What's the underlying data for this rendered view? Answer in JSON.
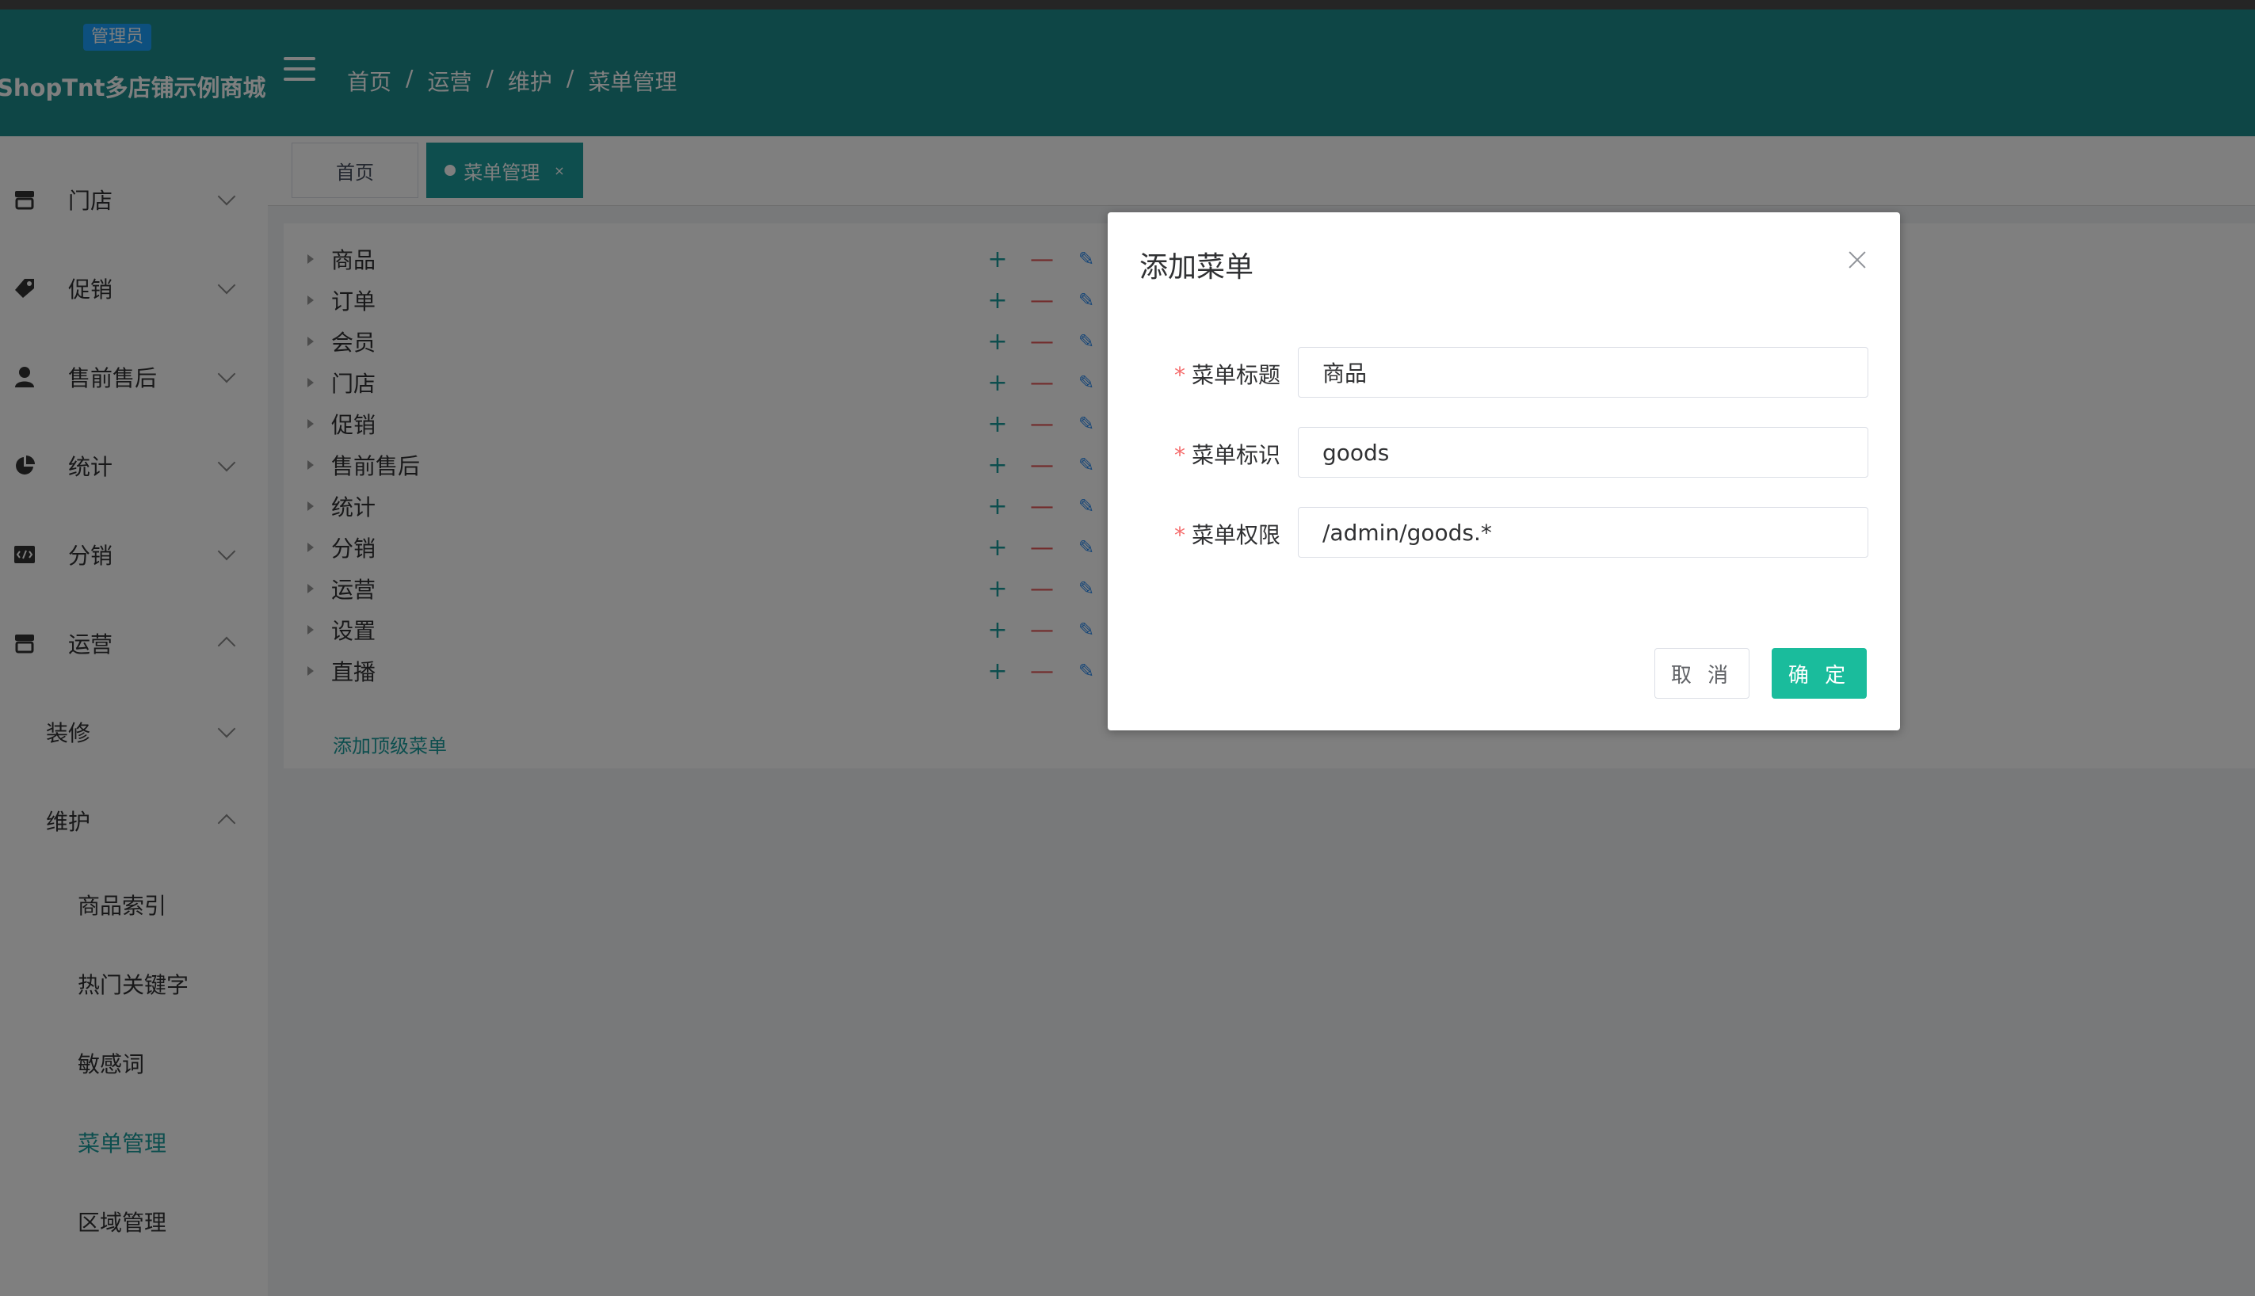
{
  "header": {
    "role_badge": "管理员",
    "shop_name": "ShopTnt多店铺示例商城",
    "breadcrumb": [
      "首页",
      "运营",
      "维护",
      "菜单管理"
    ],
    "separator": "/"
  },
  "sidebar": {
    "items": [
      {
        "label": "门店",
        "icon": "store-icon"
      },
      {
        "label": "促销",
        "icon": "tag-icon"
      },
      {
        "label": "售前售后",
        "icon": "user-icon"
      },
      {
        "label": "统计",
        "icon": "pie-chart-icon"
      },
      {
        "label": "分销",
        "icon": "code-icon"
      },
      {
        "label": "运营",
        "icon": "store-icon"
      }
    ],
    "subitems": [
      "装修",
      "维护"
    ],
    "leaf_items": [
      "商品索引",
      "热门关键字",
      "敏感词",
      "菜单管理",
      "区域管理"
    ],
    "active_item": "菜单管理"
  },
  "tabs": {
    "home": "首页",
    "active": "菜单管理",
    "close_glyph": "×"
  },
  "tree": {
    "nodes": [
      "商品",
      "订单",
      "会员",
      "门店",
      "促销",
      "售前售后",
      "统计",
      "分销",
      "运营",
      "设置",
      "直播"
    ],
    "add_glyph": "+",
    "remove_glyph": "—",
    "edit_glyph": "✎",
    "add_top_label": "添加顶级菜单"
  },
  "dialog": {
    "title": "添加菜单",
    "fields": [
      {
        "label": "菜单标题",
        "value": "商品"
      },
      {
        "label": "菜单标识",
        "value": "goods"
      },
      {
        "label": "菜单权限",
        "value": "/admin/goods.*"
      }
    ],
    "required_mark": "*",
    "cancel_label": "取 消",
    "ok_label": "确 定"
  },
  "colors": {
    "header": "#1c8c8c",
    "accent": "#1a9c9c",
    "confirm": "#1abc9c",
    "danger": "#e45656"
  }
}
